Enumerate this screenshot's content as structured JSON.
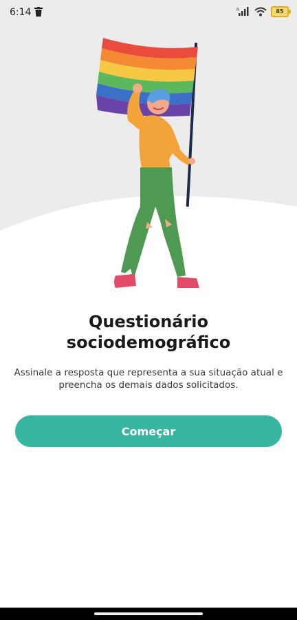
{
  "status_bar": {
    "time": "6:14",
    "battery": "85"
  },
  "onboarding": {
    "title_line1": "Questionário",
    "title_line2": "sociodemográfico",
    "description": "Assinale a resposta que representa a sua situação atual e preencha os demais dados solicitados.",
    "start_button_label": "Começar"
  },
  "colors": {
    "accent": "#38b5a1",
    "hero_background": "#ececec",
    "flag_stripes": [
      "#e94b3c",
      "#f58a34",
      "#f7c844",
      "#5cb85c",
      "#3b6fc8",
      "#6a43a8"
    ]
  },
  "icons": [
    "trash-icon",
    "signal-icon",
    "wifi-icon",
    "battery-icon"
  ]
}
